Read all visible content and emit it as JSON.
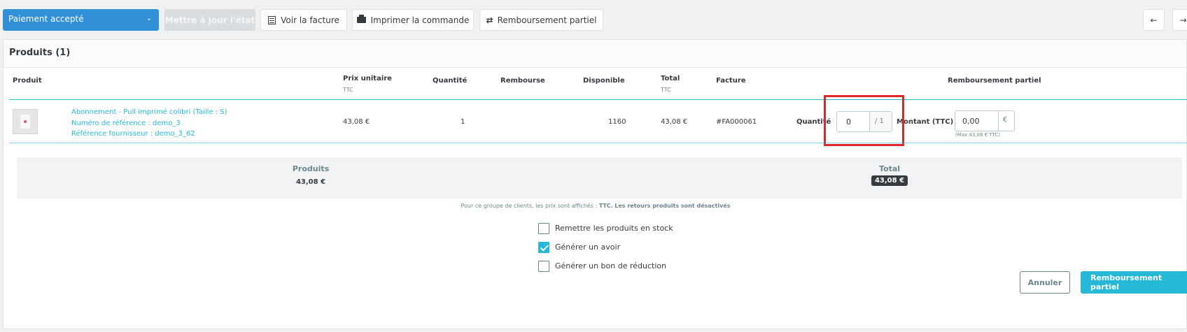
{
  "toolbar": {
    "status_select": "Paiement accepté",
    "update_state": "Mettre à jour l'état",
    "view_invoice": "Voir la facture",
    "print_order": "Imprimer la commande",
    "partial_refund": "Remboursement partiel",
    "prev_icon": "arrow-left-icon",
    "next_icon": "arrow-right-icon"
  },
  "card": {
    "title": "Produits (1)"
  },
  "table": {
    "headers": {
      "product": "Produit",
      "unit_price": "Prix unitaire",
      "unit_price_sub": "TTC",
      "quantity": "Quantité",
      "refunded": "Rembourse",
      "available": "Disponible",
      "total": "Total",
      "total_sub": "TTC",
      "invoice": "Facture",
      "partial_refund": "Remboursement partiel"
    },
    "row": {
      "name": "Abonnement - Pull imprimé colibri (Taille : S)",
      "reference": "Numéro de référence : demo_3",
      "supplier_reference": "Référence fournisseur : demo_3_62",
      "unit_price": "43,08 €",
      "quantity": "1",
      "available": "1160",
      "total": "43,08 €",
      "invoice": "#FA000061",
      "refund_qty_label": "Quantité",
      "refund_qty_value": "0",
      "refund_qty_max": "/ 1",
      "refund_amount_label": "Montant (TTC)",
      "refund_amount_value": "0,00",
      "currency": "€",
      "max_note": "(Max 43,08 € TTC)"
    }
  },
  "totals": {
    "products_label": "Produits",
    "products_value": "43,08 €",
    "total_label": "Total",
    "total_value": "43,08 €"
  },
  "note": {
    "prefix": "Pour ce groupe de clients, les prix sont affichés : ",
    "tax": "TTC.",
    "returns": "Les retours produits sont désactivés"
  },
  "options": [
    {
      "label": "Remettre les produits en stock",
      "checked": false
    },
    {
      "label": "Générer un avoir",
      "checked": true
    },
    {
      "label": "Générer un bon de réduction",
      "checked": false
    }
  ],
  "actions": {
    "cancel": "Annuler",
    "submit": "Remboursement partiel"
  },
  "colors": {
    "accent": "#25b9d7",
    "status": "#3190d8",
    "highlight": "#e0262b"
  }
}
